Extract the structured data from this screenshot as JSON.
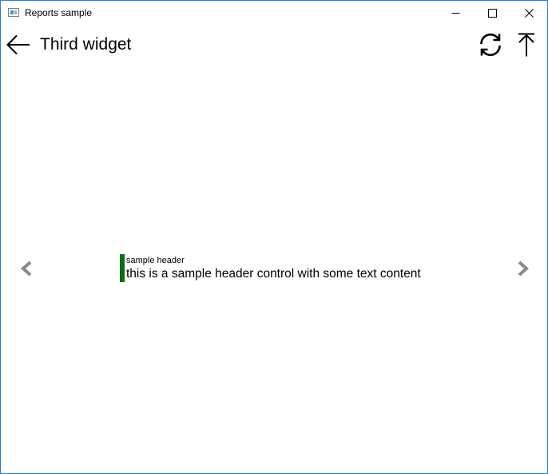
{
  "window": {
    "title": "Reports sample",
    "icon": "app-window-icon",
    "controls": {
      "minimize_icon": "minimize-icon",
      "maximize_icon": "maximize-icon",
      "close_icon": "close-icon"
    }
  },
  "header": {
    "title": "Third widget",
    "back_icon": "back-arrow-icon",
    "refresh_icon": "refresh-icon",
    "top_icon": "scroll-to-top-icon"
  },
  "content": {
    "header_control": {
      "label": "sample header",
      "text": "this is a sample header control with some text content",
      "accent_color": "#0b6e14"
    },
    "prev_icon": "chevron-left-icon",
    "next_icon": "chevron-right-icon"
  },
  "colors": {
    "window_border": "#2b7bd4",
    "nav_arrow": "#8a8a8a"
  }
}
